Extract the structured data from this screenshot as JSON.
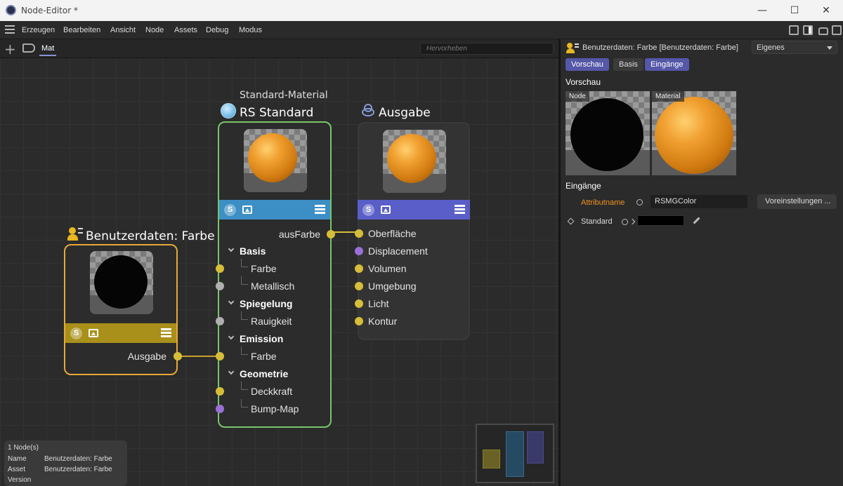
{
  "window": {
    "title": "Node-Editor *",
    "min": "—",
    "max": "☐",
    "close": "✕"
  },
  "menu": [
    "Erzeugen",
    "Bearbeiten",
    "Ansicht",
    "Node",
    "Assets",
    "Debug",
    "Modus"
  ],
  "tab": {
    "label": "Mat",
    "search_placeholder": "Hervorheben"
  },
  "nodes": {
    "user_data": {
      "title": "Benutzerdaten: Farbe",
      "output": "Ausgabe",
      "color": "#e8a838"
    },
    "standard": {
      "subtitle": "Standard-Material",
      "title": "RS Standard",
      "output": "ausFarbe",
      "bar_color": "#3b8fc4",
      "border": "#76c66a",
      "ports": [
        {
          "label": "Basis",
          "group": true
        },
        {
          "label": "Farbe",
          "group": false,
          "dot": "y"
        },
        {
          "label": "Metallisch",
          "group": false,
          "dot": "g"
        },
        {
          "label": "Spiegelung",
          "group": true
        },
        {
          "label": "Rauigkeit",
          "group": false,
          "dot": "g"
        },
        {
          "label": "Emission",
          "group": true
        },
        {
          "label": "Farbe",
          "group": false,
          "dot": "y"
        },
        {
          "label": "Geometrie",
          "group": true
        },
        {
          "label": "Deckkraft",
          "group": false,
          "dot": "y"
        },
        {
          "label": "Bump-Map",
          "group": false,
          "dot": "p"
        }
      ]
    },
    "output": {
      "title": "Ausgabe",
      "bar_color": "#5a5ec8",
      "ports": [
        {
          "label": "Oberfläche",
          "dot": "y"
        },
        {
          "label": "Displacement",
          "dot": "p"
        },
        {
          "label": "Volumen",
          "dot": "y"
        },
        {
          "label": "Umgebung",
          "dot": "y"
        },
        {
          "label": "Licht",
          "dot": "y"
        },
        {
          "label": "Kontur",
          "dot": "y"
        }
      ]
    }
  },
  "info": {
    "count": "1 Node(s)",
    "name_label": "Name",
    "name_value": "Benutzerdaten: Farbe",
    "asset_label": "Asset",
    "asset_value": "Benutzerdaten: Farbe",
    "version_label": "Version"
  },
  "panel": {
    "header": "Benutzerdaten: Farbe [Benutzerdaten: Farbe]",
    "dropdown": "Eigenes",
    "tabs": [
      "Vorschau",
      "Basis",
      "Eingänge"
    ],
    "preview_title": "Vorschau",
    "preview_node": "Node",
    "preview_material": "Material",
    "inputs_title": "Eingänge",
    "attr_label": "Attributname",
    "attr_value": "RSMGColor",
    "presets_button": "Voreinstellungen ...",
    "default_label": "Standard"
  }
}
